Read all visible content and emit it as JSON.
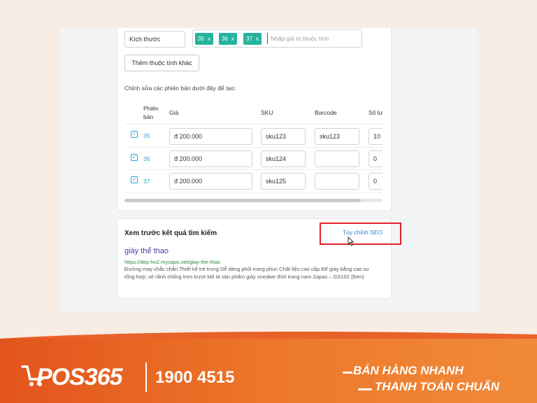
{
  "attribute": {
    "name_value": "Kích thước",
    "tags": [
      {
        "label": "35",
        "remove": "x"
      },
      {
        "label": "36",
        "remove": "x"
      },
      {
        "label": "37",
        "remove": "x"
      }
    ],
    "input_placeholder": "Nhập giá trị thuộc tính",
    "add_button": "Thêm thuộc tính khác"
  },
  "variants": {
    "instruction": "Chỉnh sửa các phiên bản dưới đây để tạo:",
    "headers": {
      "version_line1": "Phiên",
      "version_line2": "bản",
      "price": "Giá",
      "sku": "SKU",
      "barcode": "Barcode",
      "quantity": "Số lư"
    },
    "rows": [
      {
        "version": "35",
        "price": "đ 200.000",
        "sku": "sku123",
        "barcode": "sku123",
        "quantity": "10",
        "checked": true
      },
      {
        "version": "36",
        "price": "đ 200.000",
        "sku": "sku124",
        "barcode": "",
        "quantity": "0",
        "checked": true
      },
      {
        "version": "37",
        "price": "đ 200.000",
        "sku": "sku125",
        "barcode": "",
        "quantity": "0",
        "checked": true
      }
    ]
  },
  "seo": {
    "heading": "Xem trước kết quả tìm kiếm",
    "customize_link": "Tùy chỉnh SEO",
    "page_title": "giày thể thao",
    "url": "https://dep-hn2.mysapo.net/giay-the-thao",
    "description": "Đường may chắc chắn Thiết kế trẻ trung Dễ dàng phối trang phục Chất liệu cao cấp Đế giày bằng cao su tổng hợp; xẻ rãnh chống trơn trượt Mô tả sản phẩm giày sneaker thời trang nam Zapas – GS102 (Đen)"
  },
  "banner": {
    "logo": "POS365",
    "phone": "1900 4515",
    "slogan_line1": "BÁN HÀNG NHANH",
    "slogan_line2": "THANH TOÁN CHUẨN"
  },
  "colors": {
    "accent": "#25b39e",
    "highlight": "#e1212b",
    "banner": "#e2541c"
  }
}
